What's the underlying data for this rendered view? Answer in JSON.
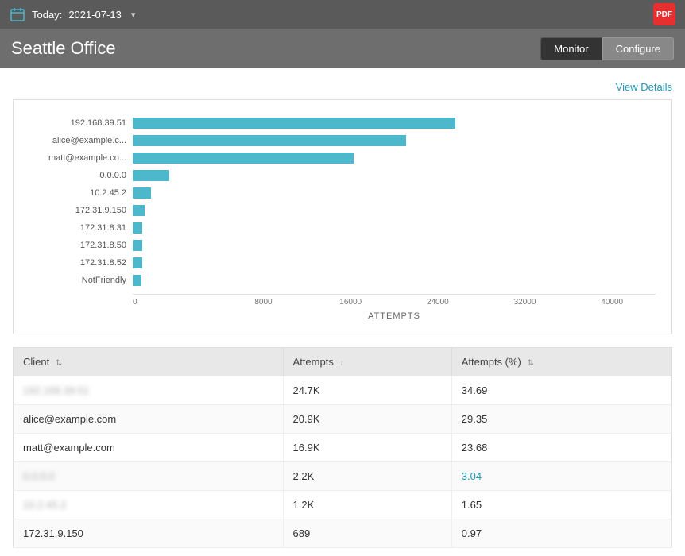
{
  "topbar": {
    "today_label": "Today:",
    "date": "2021-07-13",
    "pdf_label": "PDF"
  },
  "header": {
    "title": "Seattle Office",
    "buttons": [
      {
        "label": "Monitor",
        "active": true
      },
      {
        "label": "Configure",
        "active": false
      }
    ]
  },
  "view_details": "View Details",
  "chart": {
    "x_axis_title": "ATTEMPTS",
    "x_labels": [
      "0",
      "8000",
      "16000",
      "24000",
      "32000",
      "40000"
    ],
    "max_value": 40000,
    "bars": [
      {
        "label": "192.168.39.51",
        "value": 24700
      },
      {
        "label": "alice@example.c...",
        "value": 20900
      },
      {
        "label": "matt@example.co...",
        "value": 16900
      },
      {
        "label": "0.0.0.0",
        "value": 2800
      },
      {
        "label": "10.2.45.2",
        "value": 1400
      },
      {
        "label": "172.31.9.150",
        "value": 900
      },
      {
        "label": "172.31.8.31",
        "value": 750
      },
      {
        "label": "172.31.8.50",
        "value": 750
      },
      {
        "label": "172.31.8.52",
        "value": 700
      },
      {
        "label": "NotFriendly",
        "value": 680
      }
    ]
  },
  "table": {
    "columns": [
      {
        "label": "Client",
        "sortable": true,
        "sort_icon": "⇅"
      },
      {
        "label": "Attempts",
        "sortable": true,
        "sort_icon": "↓"
      },
      {
        "label": "Attempts (%)",
        "sortable": true,
        "sort_icon": "⇅"
      }
    ],
    "rows": [
      {
        "client": "192.168.39.51",
        "client_blurred": true,
        "attempts": "24.7K",
        "attempts_pct": "34.69",
        "pct_blue": false
      },
      {
        "client": "alice@example.com",
        "client_blurred": false,
        "attempts": "20.9K",
        "attempts_pct": "29.35",
        "pct_blue": false
      },
      {
        "client": "matt@example.com",
        "client_blurred": false,
        "attempts": "16.9K",
        "attempts_pct": "23.68",
        "pct_blue": false
      },
      {
        "client": "0.0.0.0",
        "client_blurred": true,
        "attempts": "2.2K",
        "attempts_pct": "3.04",
        "pct_blue": true
      },
      {
        "client": "10.2.45.2",
        "client_blurred": true,
        "attempts": "1.2K",
        "attempts_pct": "1.65",
        "pct_blue": false
      },
      {
        "client": "172.31.9.150",
        "client_blurred": false,
        "attempts": "689",
        "attempts_pct": "0.97",
        "pct_blue": false
      }
    ]
  }
}
